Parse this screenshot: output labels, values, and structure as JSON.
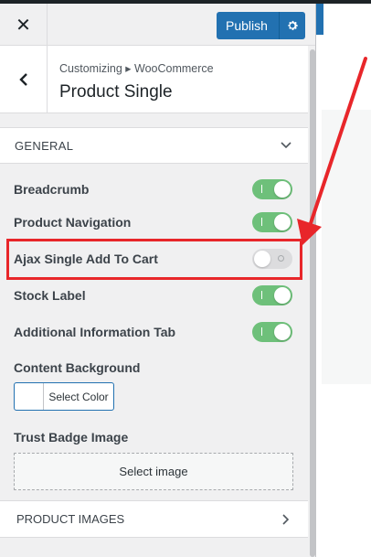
{
  "header": {
    "close_glyph": "✕",
    "publish_label": "Publish",
    "accent_color": "#2271b1"
  },
  "section": {
    "breadcrumb": "Customizing ▸ WooCommerce",
    "title": "Product Single"
  },
  "general": {
    "label": "GENERAL",
    "expanded": true
  },
  "toggles": [
    {
      "label": "Breadcrumb",
      "on": true
    },
    {
      "label": "Product Navigation",
      "on": true
    },
    {
      "label": "Ajax Single Add To Cart",
      "on": false
    },
    {
      "label": "Stock Label",
      "on": true
    },
    {
      "label": "Additional Information Tab",
      "on": true
    }
  ],
  "content_background": {
    "label": "Content Background",
    "button_label": "Select Color"
  },
  "trust_badge": {
    "label": "Trust Badge Image",
    "button_label": "Select image"
  },
  "product_images": {
    "label": "PRODUCT IMAGES"
  },
  "colors": {
    "toggle_on": "#6ec07a",
    "toggle_off": "#dcdcde",
    "highlight": "#e8262a"
  },
  "icons": {
    "close": "close-icon",
    "gear": "gear-icon",
    "back": "chevron-left-icon",
    "general_toggle": "chevron-down-icon",
    "product_images_toggle": "chevron-right-icon"
  }
}
